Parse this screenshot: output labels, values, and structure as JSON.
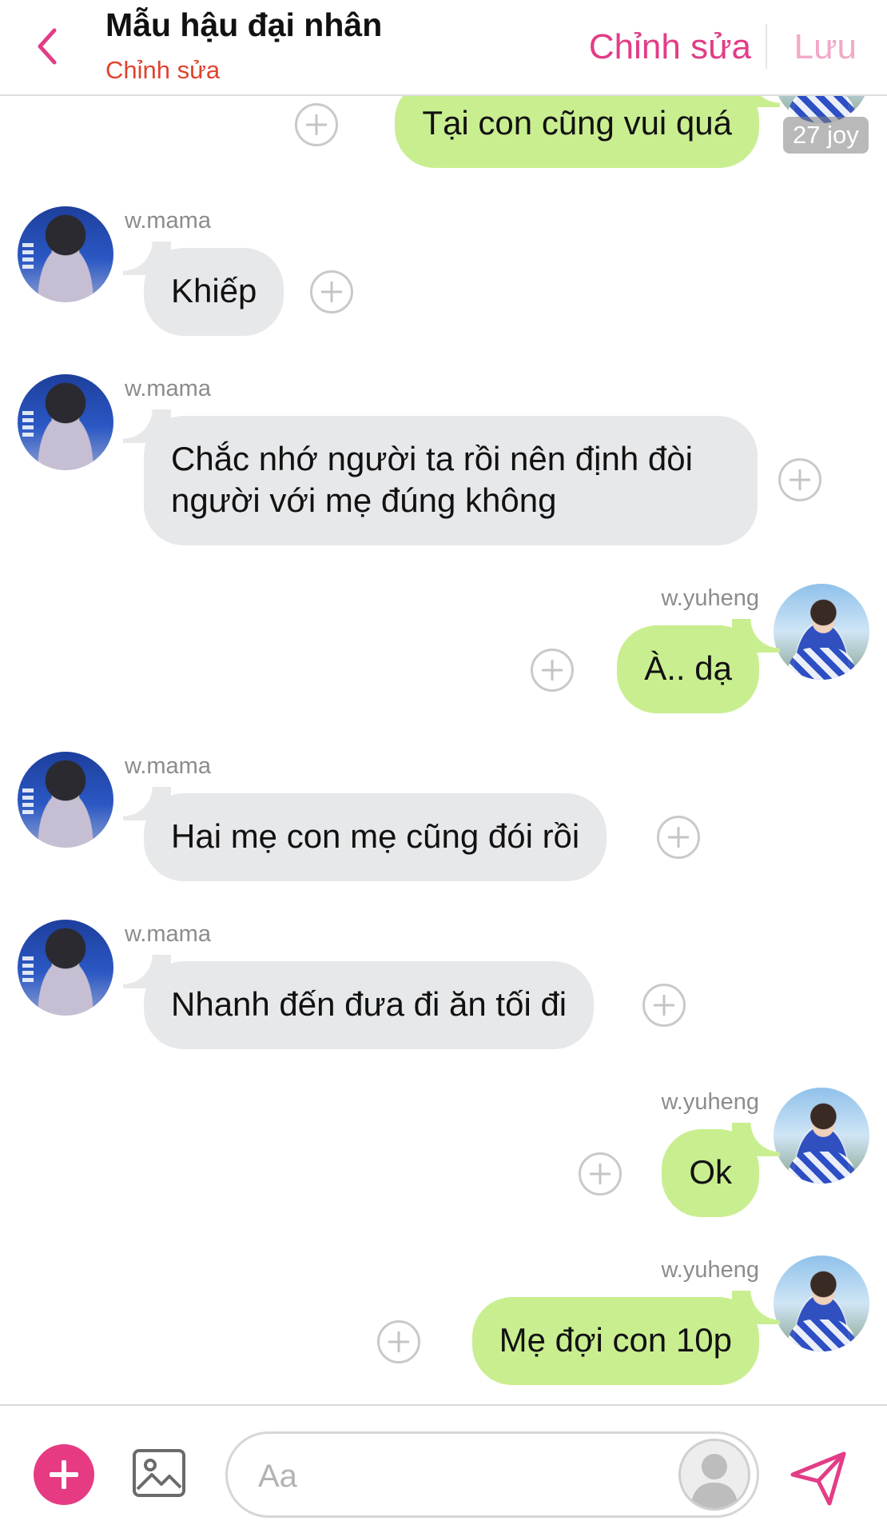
{
  "header": {
    "title": "Mẫu hậu đại nhân",
    "subtitle": "Chỉnh sửa",
    "edit_label": "Chỉnh sửa",
    "save_label": "Lưu",
    "accent_color": "#e23d86"
  },
  "messages": [
    {
      "side": "right",
      "text": "Tại con cũng vui quá",
      "timestamp_badge": "27 joy"
    },
    {
      "side": "left",
      "sender": "w.mama",
      "text": "Khiếp"
    },
    {
      "side": "left",
      "sender": "w.mama",
      "text": "Chắc nhớ người ta rồi nên định đòi người với mẹ đúng không"
    },
    {
      "side": "right",
      "sender": "w.yuheng",
      "text": "À.. dạ"
    },
    {
      "side": "left",
      "sender": "w.mama",
      "text": "Hai mẹ con mẹ cũng đói rồi"
    },
    {
      "side": "left",
      "sender": "w.mama",
      "text": "Nhanh đến đưa đi ăn tối đi"
    },
    {
      "side": "right",
      "sender": "w.yuheng",
      "text": "Ok"
    },
    {
      "side": "right",
      "sender": "w.yuheng",
      "text": "Mẹ đợi con 10p"
    }
  ],
  "input": {
    "placeholder": "Aa",
    "value": ""
  },
  "colors": {
    "left_bubble": "#e7e8ea",
    "right_bubble": "#c9ee90",
    "add_button": "#e63b83",
    "send_icon": "#e23d86"
  }
}
